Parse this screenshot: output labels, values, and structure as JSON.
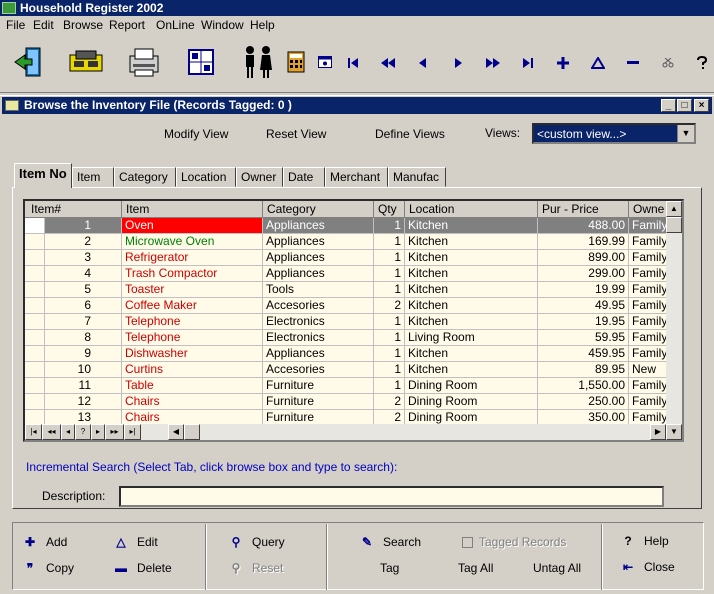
{
  "app": {
    "title": "Household Register 2002"
  },
  "menu": [
    "File",
    "Edit",
    "Browse",
    "Report",
    "OnLine",
    "Window",
    "Help"
  ],
  "toolbar": {
    "icons": [
      "exit-door-icon",
      "tape-drive-icon",
      "printer-icon",
      "calendar-grid-icon",
      "people-icon",
      "calculator-icon",
      "small-window-icon"
    ],
    "nav": [
      "first-record-icon",
      "rewind-icon",
      "previous-icon",
      "next-icon",
      "fast-forward-icon",
      "last-record-icon",
      "add-icon",
      "edit-triangle-icon",
      "delete-minus-icon",
      "scissors-icon",
      "help-question-icon"
    ]
  },
  "window": {
    "title": "Browse the Inventory File  (Records Tagged:  0 )"
  },
  "view_links": {
    "modify": "Modify View",
    "reset": "Reset View",
    "define": "Define Views",
    "views_label": "Views:",
    "views_value": "<custom view...>"
  },
  "tabs": [
    "Item No",
    "Item",
    "Category",
    "Location",
    "Owner",
    "Date",
    "Merchant",
    "Manufac"
  ],
  "grid": {
    "headers": [
      "Item#",
      "Item",
      "Category",
      "Qty",
      "Location",
      "Pur - Price",
      "Owne"
    ],
    "rows": [
      [
        "1",
        "Oven",
        "Appliances",
        "1",
        "Kitchen",
        "488.00",
        "Family"
      ],
      [
        "2",
        "Microwave Oven",
        "Appliances",
        "1",
        "Kitchen",
        "169.99",
        "Family"
      ],
      [
        "3",
        "Refrigerator",
        "Appliances",
        "1",
        "Kitchen",
        "899.00",
        "Family"
      ],
      [
        "4",
        "Trash Compactor",
        "Appliances",
        "1",
        "Kitchen",
        "299.00",
        "Family"
      ],
      [
        "5",
        "Toaster",
        "Tools",
        "1",
        "Kitchen",
        "19.99",
        "Family"
      ],
      [
        "6",
        "Coffee Maker",
        "Accesories",
        "2",
        "Kitchen",
        "49.95",
        "Family"
      ],
      [
        "7",
        "Telephone",
        "Electronics",
        "1",
        "Kitchen",
        "19.95",
        "Family"
      ],
      [
        "8",
        "Telephone",
        "Electronics",
        "1",
        "Living Room",
        "59.95",
        "Family"
      ],
      [
        "9",
        "Dishwasher",
        "Appliances",
        "1",
        "Kitchen",
        "459.95",
        "Family"
      ],
      [
        "10",
        "Curtins",
        "Accesories",
        "1",
        "Kitchen",
        "89.95",
        "New"
      ],
      [
        "11",
        "Table",
        "Furniture",
        "1",
        "Dining Room",
        "1,550.00",
        "Family"
      ],
      [
        "12",
        "Chairs",
        "Furniture",
        "2",
        "Dining Room",
        "250.00",
        "Family"
      ],
      [
        "13",
        "Chairs",
        "Furniture",
        "2",
        "Dining Room",
        "350.00",
        "Family"
      ]
    ],
    "item_colors": [
      "#ffffff",
      "#008000",
      "#cc0000",
      "#cc0000",
      "#cc0000",
      "#cc0000",
      "#cc0000",
      "#cc0000",
      "#cc0000",
      "#cc0000",
      "#cc0000",
      "#cc0000",
      "#cc0000"
    ],
    "record_nav": [
      "|◂",
      "◂◂",
      "◂",
      "?",
      "▸",
      "▸▸",
      "▸|"
    ]
  },
  "search": {
    "hint": "Incremental Search (Select Tab, click browse box and type to search):",
    "description_label": "Description:",
    "description_value": ""
  },
  "actions": {
    "add": "Add",
    "copy": "Copy",
    "edit": "Edit",
    "delete": "Delete",
    "query": "Query",
    "reset": "Reset",
    "search": "Search",
    "tag": "Tag",
    "tagged_records": "Tagged Records",
    "tag_all": "Tag All",
    "untag_all": "Untag All",
    "help": "Help",
    "close": "Close"
  }
}
